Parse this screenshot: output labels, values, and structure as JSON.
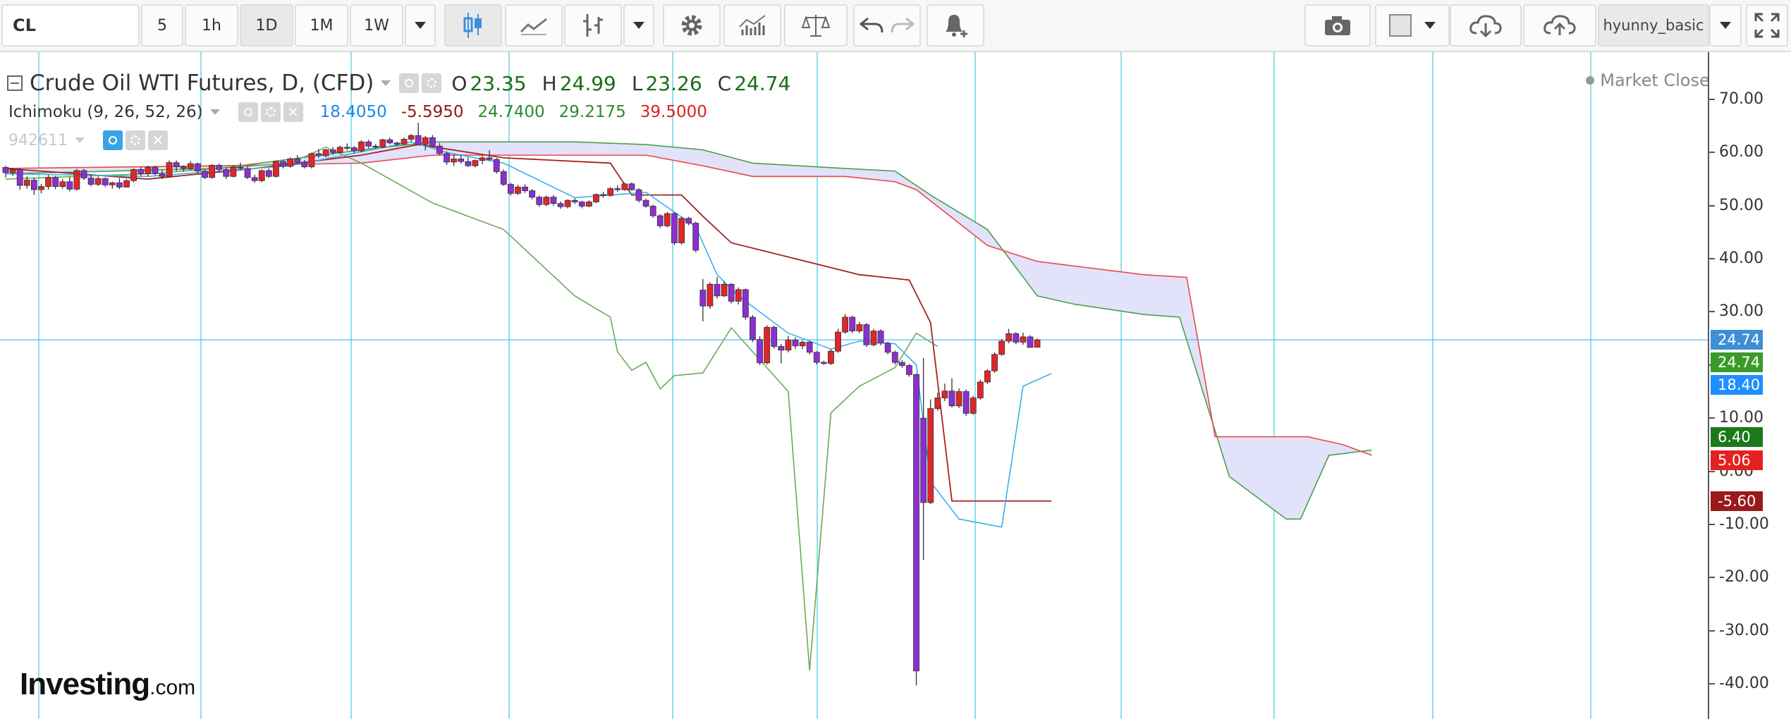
{
  "toolbar": {
    "symbol": "CL",
    "intervals": [
      "5",
      "1h",
      "1D",
      "1M",
      "1W"
    ],
    "active_interval": "1D",
    "user": "hyunny_basic",
    "icons": [
      "candles-icon",
      "line-chart-icon",
      "bars-icon",
      "chevron-down-icon",
      "gear-icon",
      "indicators-icon",
      "compare-scale-icon",
      "undo-icon",
      "redo-icon",
      "alert-bell-icon",
      "camera-icon",
      "color-square-icon",
      "cloud-download-icon",
      "cloud-upload-icon",
      "fullscreen-icon"
    ]
  },
  "legend": {
    "title": "Crude Oil WTI Futures, D, (CFD)",
    "ohlc": [
      {
        "label": "O",
        "value": "23.35"
      },
      {
        "label": "H",
        "value": "24.99"
      },
      {
        "label": "L",
        "value": "23.26"
      },
      {
        "label": "C",
        "value": "24.74"
      }
    ],
    "indicator": {
      "name": "Ichimoku (9, 26, 52, 26)",
      "values": [
        {
          "value": "18.4050",
          "color": "#1e88e5"
        },
        {
          "value": "-5.5950",
          "color": "#8b1a1a"
        },
        {
          "value": "24.7400",
          "color": "#2e8b2e"
        },
        {
          "value": "29.2175",
          "color": "#2e8b2e"
        },
        {
          "value": "39.5000",
          "color": "#e02020"
        }
      ]
    },
    "hidden_study": "942611"
  },
  "market_status": "Market Closed",
  "price_axis": {
    "ticks": [
      "70.00",
      "60.00",
      "50.00",
      "40.00",
      "30.00",
      "20.00",
      "10.00",
      "0.00",
      "-10.00",
      "-20.00",
      "-30.00",
      "-40.00"
    ],
    "labels": [
      {
        "text": "24.74",
        "color": "#3d8fd6",
        "value": 24.74
      },
      {
        "text": "24.74",
        "color": "#3a9a2a",
        "value": 20.5
      },
      {
        "text": "18.40",
        "color": "#1e90ff",
        "value": 16.2
      },
      {
        "text": "6.40",
        "color": "#1a7a1a",
        "value": 6.4
      },
      {
        "text": "5.06",
        "color": "#e52020",
        "value": 2.0
      },
      {
        "text": "-5.60",
        "color": "#9a1a1a",
        "value": -5.6
      }
    ]
  },
  "logo": {
    "bold": "Investing",
    "suffix": ".com"
  },
  "colors": {
    "candle_up": "#e0262a",
    "candle_down": "#8c2fd2",
    "tenkan": "#3ab0f0",
    "kijun": "#a82020",
    "chikou": "#6aaa5a",
    "span_a": "#4aa04a",
    "span_b": "#e84a4a",
    "cloud": "#e2e2fa",
    "grid_v": "#66d7e0"
  },
  "chart_data": {
    "type": "candlestick",
    "ylim": [
      -43,
      75
    ],
    "last_price": 24.74,
    "candles": [
      [
        57.2,
        57.5,
        55.3,
        56.2
      ],
      [
        56.2,
        57.1,
        55.6,
        56.8
      ],
      [
        56.8,
        57.0,
        53.0,
        53.8
      ],
      [
        53.8,
        55.5,
        53.2,
        54.8
      ],
      [
        54.8,
        55.3,
        52.0,
        53.0
      ],
      [
        53.0,
        54.1,
        52.3,
        53.6
      ],
      [
        53.6,
        55.8,
        53.0,
        55.3
      ],
      [
        55.3,
        55.6,
        53.1,
        53.6
      ],
      [
        53.6,
        55.0,
        53.2,
        54.5
      ],
      [
        54.5,
        55.4,
        52.7,
        53.1
      ],
      [
        53.1,
        56.9,
        52.8,
        56.6
      ],
      [
        56.6,
        56.9,
        54.8,
        55.2
      ],
      [
        55.2,
        55.8,
        53.6,
        54.0
      ],
      [
        54.0,
        55.5,
        53.7,
        55.1
      ],
      [
        55.1,
        55.3,
        53.5,
        53.9
      ],
      [
        53.9,
        54.5,
        53.2,
        54.3
      ],
      [
        54.3,
        55.2,
        53.1,
        53.5
      ],
      [
        53.5,
        55.0,
        53.4,
        54.7
      ],
      [
        54.7,
        57.0,
        54.4,
        56.8
      ],
      [
        56.8,
        57.3,
        55.6,
        56.0
      ],
      [
        56.0,
        57.5,
        55.5,
        57.2
      ],
      [
        57.2,
        57.5,
        55.7,
        56.0
      ],
      [
        56.0,
        56.7,
        55.0,
        55.5
      ],
      [
        55.5,
        58.5,
        55.3,
        58.1
      ],
      [
        58.1,
        58.5,
        56.5,
        57.3
      ],
      [
        57.3,
        57.6,
        56.4,
        57.0
      ],
      [
        57.0,
        58.4,
        56.7,
        57.9
      ],
      [
        57.9,
        58.1,
        56.0,
        56.5
      ],
      [
        56.5,
        56.8,
        55.0,
        55.3
      ],
      [
        55.3,
        57.8,
        55.1,
        57.6
      ],
      [
        57.6,
        57.9,
        56.2,
        56.8
      ],
      [
        56.8,
        57.2,
        55.0,
        55.5
      ],
      [
        55.5,
        57.5,
        55.3,
        57.2
      ],
      [
        57.2,
        58.1,
        56.6,
        57.0
      ],
      [
        57.0,
        57.4,
        55.0,
        55.3
      ],
      [
        55.3,
        55.8,
        54.3,
        54.7
      ],
      [
        54.7,
        56.8,
        54.4,
        56.6
      ],
      [
        56.6,
        57.0,
        55.2,
        55.5
      ],
      [
        55.5,
        58.5,
        55.3,
        58.3
      ],
      [
        58.3,
        58.6,
        57.0,
        57.4
      ],
      [
        57.4,
        59.1,
        57.1,
        58.8
      ],
      [
        58.8,
        59.5,
        57.8,
        58.2
      ],
      [
        58.2,
        58.6,
        57.0,
        57.3
      ],
      [
        57.3,
        60.0,
        57.0,
        59.8
      ],
      [
        59.8,
        60.6,
        59.0,
        59.4
      ],
      [
        59.4,
        60.7,
        59.1,
        60.5
      ],
      [
        60.5,
        61.0,
        59.6,
        60.0
      ],
      [
        60.0,
        61.3,
        59.8,
        61.0
      ],
      [
        61.0,
        61.7,
        60.4,
        60.9
      ],
      [
        60.9,
        61.2,
        59.9,
        60.3
      ],
      [
        60.3,
        62.3,
        60.1,
        62.0
      ],
      [
        62.0,
        62.4,
        60.8,
        61.2
      ],
      [
        61.2,
        61.6,
        60.7,
        61.0
      ],
      [
        61.0,
        62.6,
        60.8,
        62.4
      ],
      [
        62.4,
        62.8,
        61.5,
        61.8
      ],
      [
        61.8,
        62.0,
        61.2,
        61.6
      ],
      [
        61.6,
        62.8,
        61.3,
        62.5
      ],
      [
        62.5,
        63.5,
        62.0,
        63.2
      ],
      [
        63.2,
        65.6,
        62.0,
        61.5
      ],
      [
        61.5,
        63.1,
        60.4,
        62.8
      ],
      [
        62.8,
        63.3,
        61.0,
        61.2
      ],
      [
        61.2,
        61.8,
        59.5,
        59.8
      ],
      [
        59.8,
        60.2,
        57.7,
        58.2
      ],
      [
        58.2,
        59.5,
        57.5,
        58.8
      ],
      [
        58.8,
        59.6,
        57.9,
        58.3
      ],
      [
        58.3,
        59.1,
        57.3,
        57.5
      ],
      [
        57.5,
        58.7,
        57.2,
        58.5
      ],
      [
        58.5,
        59.4,
        57.8,
        59.0
      ],
      [
        59.0,
        60.4,
        58.4,
        58.7
      ],
      [
        58.7,
        59.0,
        56.0,
        56.4
      ],
      [
        56.4,
        56.8,
        53.7,
        54.0
      ],
      [
        54.0,
        54.3,
        51.9,
        52.3
      ],
      [
        52.3,
        53.9,
        52.0,
        53.5
      ],
      [
        53.5,
        54.0,
        52.4,
        52.8
      ],
      [
        52.8,
        53.1,
        51.2,
        51.6
      ],
      [
        51.6,
        51.9,
        49.8,
        50.2
      ],
      [
        50.2,
        51.9,
        49.9,
        51.6
      ],
      [
        51.6,
        52.0,
        50.0,
        50.4
      ],
      [
        50.4,
        50.8,
        49.4,
        49.8
      ],
      [
        49.8,
        51.2,
        49.5,
        51.0
      ],
      [
        51.0,
        51.4,
        50.3,
        50.7
      ],
      [
        50.7,
        50.9,
        49.5,
        49.9
      ],
      [
        49.9,
        51.0,
        49.7,
        50.7
      ],
      [
        50.7,
        52.3,
        50.5,
        52.1
      ],
      [
        52.1,
        52.6,
        51.5,
        51.9
      ],
      [
        51.9,
        53.5,
        51.7,
        53.2
      ],
      [
        53.2,
        53.8,
        52.6,
        53.0
      ],
      [
        53.0,
        54.3,
        52.8,
        54.1
      ],
      [
        54.1,
        54.4,
        52.8,
        53.0
      ],
      [
        53.0,
        53.3,
        50.6,
        51.0
      ],
      [
        51.0,
        51.3,
        49.6,
        49.9
      ],
      [
        49.9,
        50.2,
        47.7,
        48.1
      ],
      [
        48.1,
        48.4,
        45.8,
        46.2
      ],
      [
        46.2,
        48.8,
        45.9,
        48.5
      ],
      [
        48.5,
        48.8,
        42.6,
        43.0
      ],
      [
        43.0,
        47.9,
        42.7,
        47.6
      ],
      [
        47.6,
        47.9,
        46.3,
        46.7
      ],
      [
        46.7,
        47.0,
        41.2,
        41.6
      ],
      [
        34.1,
        36.2,
        28.2,
        31.1
      ],
      [
        31.1,
        35.6,
        30.6,
        35.2
      ],
      [
        35.2,
        36.6,
        32.5,
        33.0
      ],
      [
        33.0,
        35.8,
        32.8,
        35.2
      ],
      [
        35.2,
        35.4,
        31.6,
        32.0
      ],
      [
        32.0,
        34.6,
        31.4,
        34.2
      ],
      [
        34.2,
        34.4,
        28.5,
        29.0
      ],
      [
        29.0,
        29.4,
        24.3,
        24.8
      ],
      [
        24.8,
        25.4,
        20.0,
        20.4
      ],
      [
        20.4,
        27.5,
        20.1,
        27.1
      ],
      [
        27.1,
        27.4,
        23.1,
        23.5
      ],
      [
        23.5,
        24.0,
        20.3,
        22.8
      ],
      [
        22.8,
        25.5,
        22.4,
        24.7
      ],
      [
        24.7,
        25.2,
        23.0,
        23.6
      ],
      [
        23.6,
        24.6,
        23.0,
        24.3
      ],
      [
        24.3,
        24.5,
        22.0,
        22.4
      ],
      [
        22.4,
        22.6,
        20.1,
        20.5
      ],
      [
        20.5,
        20.8,
        20.0,
        20.3
      ],
      [
        20.3,
        23.0,
        20.0,
        22.6
      ],
      [
        22.6,
        26.8,
        22.3,
        26.2
      ],
      [
        26.2,
        29.6,
        25.9,
        29.0
      ],
      [
        29.0,
        29.3,
        26.0,
        26.4
      ],
      [
        26.4,
        28.1,
        26.0,
        27.6
      ],
      [
        27.6,
        27.9,
        23.4,
        23.8
      ],
      [
        23.8,
        26.8,
        23.5,
        26.4
      ],
      [
        26.4,
        26.7,
        23.7,
        24.1
      ],
      [
        24.1,
        24.4,
        22.0,
        22.4
      ],
      [
        22.4,
        22.7,
        20.1,
        20.5
      ],
      [
        20.5,
        20.9,
        19.5,
        19.9
      ],
      [
        19.9,
        20.2,
        17.8,
        18.2
      ],
      [
        18.2,
        18.4,
        -40.3,
        -37.6
      ],
      [
        10.0,
        21.3,
        -16.7,
        -5.9
      ],
      [
        -5.9,
        13.5,
        -6.2,
        11.8
      ],
      [
        11.8,
        14.8,
        11.4,
        13.8
      ],
      [
        13.8,
        16.5,
        13.2,
        15.1
      ],
      [
        15.1,
        17.5,
        12.0,
        12.3
      ],
      [
        12.3,
        15.6,
        11.9,
        15.0
      ],
      [
        15.0,
        15.4,
        10.4,
        10.9
      ],
      [
        10.9,
        14.2,
        10.6,
        13.8
      ],
      [
        13.8,
        17.2,
        13.5,
        16.8
      ],
      [
        16.8,
        19.2,
        16.4,
        18.9
      ],
      [
        18.9,
        22.4,
        18.5,
        22.0
      ],
      [
        22.0,
        24.9,
        21.7,
        24.5
      ],
      [
        24.5,
        26.8,
        24.1,
        25.9
      ],
      [
        25.9,
        26.2,
        23.9,
        24.3
      ],
      [
        24.3,
        26.1,
        23.8,
        25.3
      ],
      [
        25.3,
        25.6,
        23.5,
        23.3
      ],
      [
        23.35,
        24.99,
        23.26,
        24.74
      ]
    ],
    "tenkan": [
      [
        0,
        56.0
      ],
      [
        20,
        55.5
      ],
      [
        40,
        57.5
      ],
      [
        57,
        62.0
      ],
      [
        62,
        60.0
      ],
      [
        70,
        58.0
      ],
      [
        80,
        51.5
      ],
      [
        90,
        52.5
      ],
      [
        97,
        46.0
      ],
      [
        100,
        37.0
      ],
      [
        103,
        33.0
      ],
      [
        110,
        26.0
      ],
      [
        116,
        23.0
      ],
      [
        120,
        24.5
      ],
      [
        125,
        24.0
      ],
      [
        128,
        20.0
      ],
      [
        130,
        -2.0
      ],
      [
        134,
        -9.0
      ],
      [
        140,
        -10.5
      ],
      [
        143,
        16.0
      ],
      [
        147,
        18.4
      ]
    ],
    "kijun": [
      [
        0,
        57.0
      ],
      [
        20,
        55.0
      ],
      [
        35,
        57.0
      ],
      [
        50,
        59.5
      ],
      [
        58,
        61.5
      ],
      [
        70,
        59.0
      ],
      [
        85,
        58.0
      ],
      [
        88,
        52.0
      ],
      [
        95,
        52.0
      ],
      [
        98,
        48.0
      ],
      [
        102,
        43.0
      ],
      [
        120,
        37.0
      ],
      [
        127,
        36.0
      ],
      [
        130,
        28.0
      ],
      [
        133,
        -5.6
      ],
      [
        147,
        -5.6
      ]
    ],
    "chikou": [
      [
        0,
        55.0
      ],
      [
        20,
        56.0
      ],
      [
        40,
        58.0
      ],
      [
        45,
        61.0
      ],
      [
        50,
        58.0
      ],
      [
        60,
        50.5
      ],
      [
        70,
        45.5
      ],
      [
        80,
        33.0
      ],
      [
        85,
        29.0
      ],
      [
        86,
        22.5
      ],
      [
        88,
        19.0
      ],
      [
        90,
        20.5
      ],
      [
        92,
        15.5
      ],
      [
        94,
        18.0
      ],
      [
        98,
        18.5
      ],
      [
        102,
        27.0
      ],
      [
        106,
        21.0
      ],
      [
        110,
        15.0
      ],
      [
        113,
        -37.5
      ],
      [
        116,
        11.0
      ],
      [
        120,
        16.0
      ],
      [
        125,
        19.5
      ],
      [
        128,
        26.0
      ],
      [
        131,
        23.5
      ]
    ],
    "span_a": [
      [
        0,
        56.0
      ],
      [
        30,
        57.0
      ],
      [
        50,
        60.5
      ],
      [
        60,
        62.0
      ],
      [
        80,
        62.0
      ],
      [
        90,
        61.5
      ],
      [
        98,
        60.5
      ],
      [
        105,
        58.0
      ],
      [
        118,
        57.0
      ],
      [
        125,
        56.5
      ],
      [
        130,
        52.0
      ],
      [
        138,
        45.5
      ],
      [
        145,
        33.0
      ],
      [
        150,
        31.5
      ],
      [
        160,
        29.5
      ],
      [
        165,
        29.0
      ],
      [
        172,
        -1.0
      ],
      [
        180,
        -9.0
      ],
      [
        182,
        -9.0
      ],
      [
        186,
        3.0
      ],
      [
        192,
        4.0
      ]
    ],
    "span_b": [
      [
        0,
        57.0
      ],
      [
        30,
        57.5
      ],
      [
        50,
        58.0
      ],
      [
        60,
        59.5
      ],
      [
        80,
        59.5
      ],
      [
        90,
        59.5
      ],
      [
        98,
        57.5
      ],
      [
        105,
        55.5
      ],
      [
        118,
        55.5
      ],
      [
        125,
        54.5
      ],
      [
        128,
        53.0
      ],
      [
        138,
        42.5
      ],
      [
        145,
        39.5
      ],
      [
        160,
        37.0
      ],
      [
        166,
        36.5
      ],
      [
        170,
        6.5
      ],
      [
        183,
        6.5
      ],
      [
        188,
        5.0
      ],
      [
        192,
        3.0
      ]
    ]
  }
}
